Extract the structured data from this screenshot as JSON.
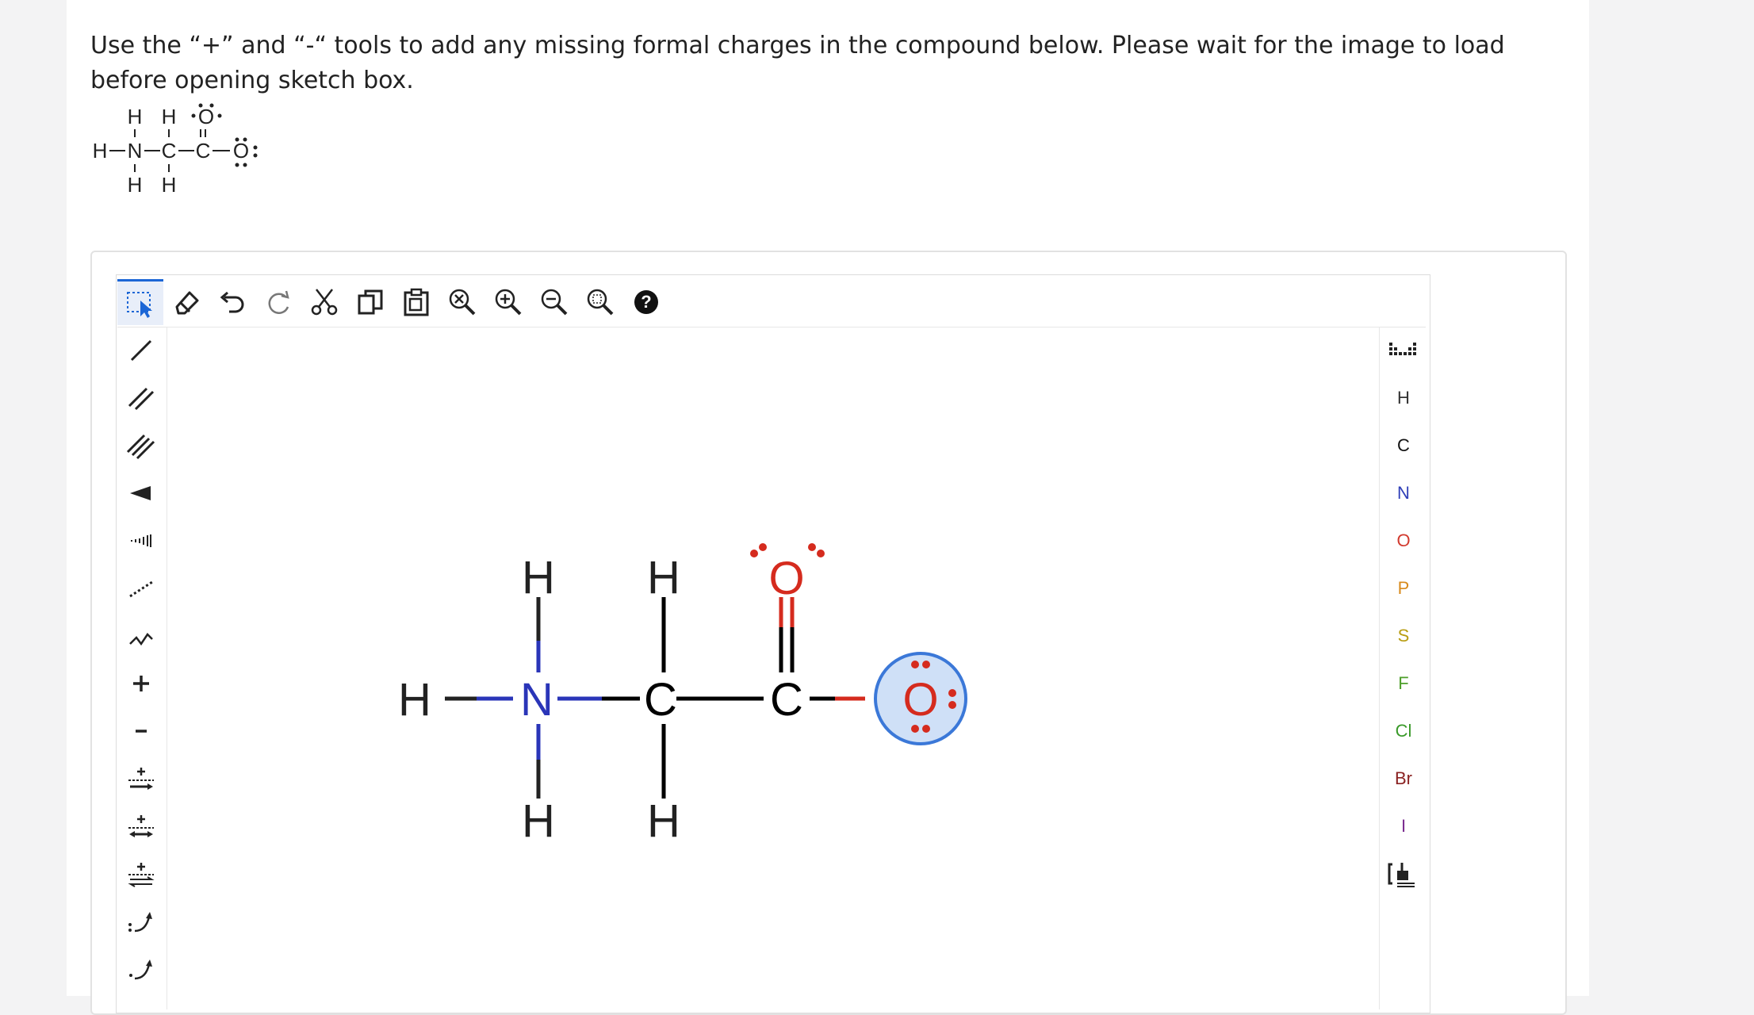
{
  "instructions": {
    "text": "Use the “+” and “-“ tools to add any missing formal charges in the compound below. Please wait for the image to load before opening sketch box."
  },
  "reference_structure": {
    "row1": [
      "H",
      "H",
      "O"
    ],
    "row2": [
      "H",
      "N",
      "C",
      "C",
      "O"
    ],
    "row3": [
      "H",
      "H"
    ]
  },
  "top_toolbar": [
    {
      "icon": "select-icon",
      "active": true
    },
    {
      "icon": "eraser-icon"
    },
    {
      "icon": "undo-icon"
    },
    {
      "icon": "redo-icon"
    },
    {
      "icon": "cut-icon"
    },
    {
      "icon": "copy-icon"
    },
    {
      "icon": "paste-icon"
    },
    {
      "icon": "zoom-fit-icon"
    },
    {
      "icon": "zoom-in-icon"
    },
    {
      "icon": "zoom-out-icon"
    },
    {
      "icon": "zoom-select-icon"
    },
    {
      "icon": "help-icon"
    }
  ],
  "left_toolbar": [
    {
      "icon": "single-bond-icon"
    },
    {
      "icon": "double-bond-icon"
    },
    {
      "icon": "triple-bond-icon"
    },
    {
      "icon": "wedge-bond-icon"
    },
    {
      "icon": "hash-bond-icon"
    },
    {
      "icon": "dashed-bond-icon"
    },
    {
      "icon": "chain-icon"
    },
    {
      "icon": "plus-charge-icon"
    },
    {
      "icon": "minus-charge-icon"
    },
    {
      "icon": "reaction-arrow-icon"
    },
    {
      "icon": "resonance-arrow-icon"
    },
    {
      "icon": "equilibrium-arrow-icon"
    },
    {
      "icon": "electron-pair-arrow-icon"
    },
    {
      "icon": "single-electron-arrow-icon"
    }
  ],
  "right_toolbar": {
    "elements": [
      {
        "label": "H",
        "color": "#333333"
      },
      {
        "label": "C",
        "color": "#111111"
      },
      {
        "label": "N",
        "color": "#2f3fb8"
      },
      {
        "label": "O",
        "color": "#d23a2e"
      },
      {
        "label": "P",
        "color": "#d88a1c"
      },
      {
        "label": "S",
        "color": "#b89d12"
      },
      {
        "label": "F",
        "color": "#4e9f2b"
      },
      {
        "label": "Cl",
        "color": "#3a9a2a"
      },
      {
        "label": "Br",
        "color": "#8a2222"
      },
      {
        "label": "I",
        "color": "#7a2b8f"
      }
    ]
  },
  "molecule": {
    "atoms": [
      "H",
      "N",
      "C",
      "C",
      "O",
      "H",
      "H",
      "H",
      "H",
      "O"
    ],
    "colors": {
      "C": "#000000",
      "N": "#2a35b8",
      "O": "#d52b1e",
      "H": "#222222",
      "highlight": "#cfe0f7",
      "highlight_ring": "#3b78d8"
    }
  }
}
